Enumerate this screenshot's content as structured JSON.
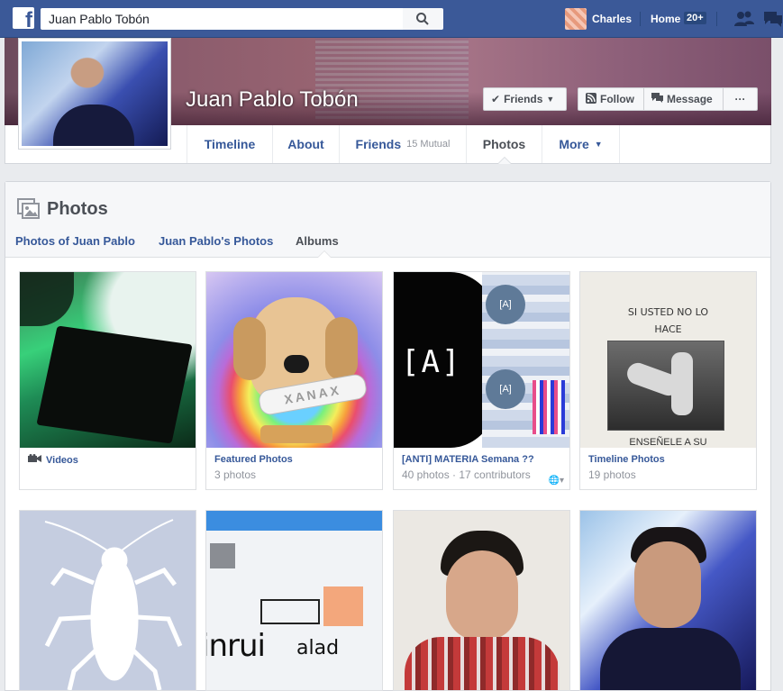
{
  "topbar": {
    "logo_text": "f",
    "search_value": "Juan Pablo Tobón",
    "user_name": "Charles",
    "home_label": "Home",
    "home_badge": "20+"
  },
  "profile": {
    "name": "Juan Pablo Tobón",
    "buttons": {
      "friends": "Friends",
      "follow": "Follow",
      "message": "Message",
      "more": "···"
    },
    "tabs": [
      {
        "label": "Timeline"
      },
      {
        "label": "About"
      },
      {
        "label": "Friends",
        "sub": "15 Mutual"
      },
      {
        "label": "Photos"
      },
      {
        "label": "More"
      }
    ]
  },
  "photos": {
    "title": "Photos",
    "tabs": [
      "Photos of Juan Pablo",
      "Juan Pablo's Photos",
      "Albums"
    ],
    "albums": [
      {
        "title": "Videos",
        "count": ""
      },
      {
        "title": "Featured Photos",
        "count": "3 photos"
      },
      {
        "title": "[ANTI] MATERIA Semana ??",
        "count": "40 photos · 17 contributors"
      },
      {
        "title": "Timeline Photos",
        "count": "19 photos"
      }
    ],
    "thumb_text": {
      "xanax": "XANAX",
      "anti": "[A]",
      "timeline_sign_top": "SI USTED NO LO",
      "timeline_sign_mid": "HACE",
      "timeline_sign_bottom": "ENSEÑELE A SU",
      "screenshot_a": "inrui",
      "screenshot_b": "alad"
    }
  },
  "colors": {
    "brand": "#3b5998",
    "link": "#365899",
    "muted": "#90949c"
  }
}
